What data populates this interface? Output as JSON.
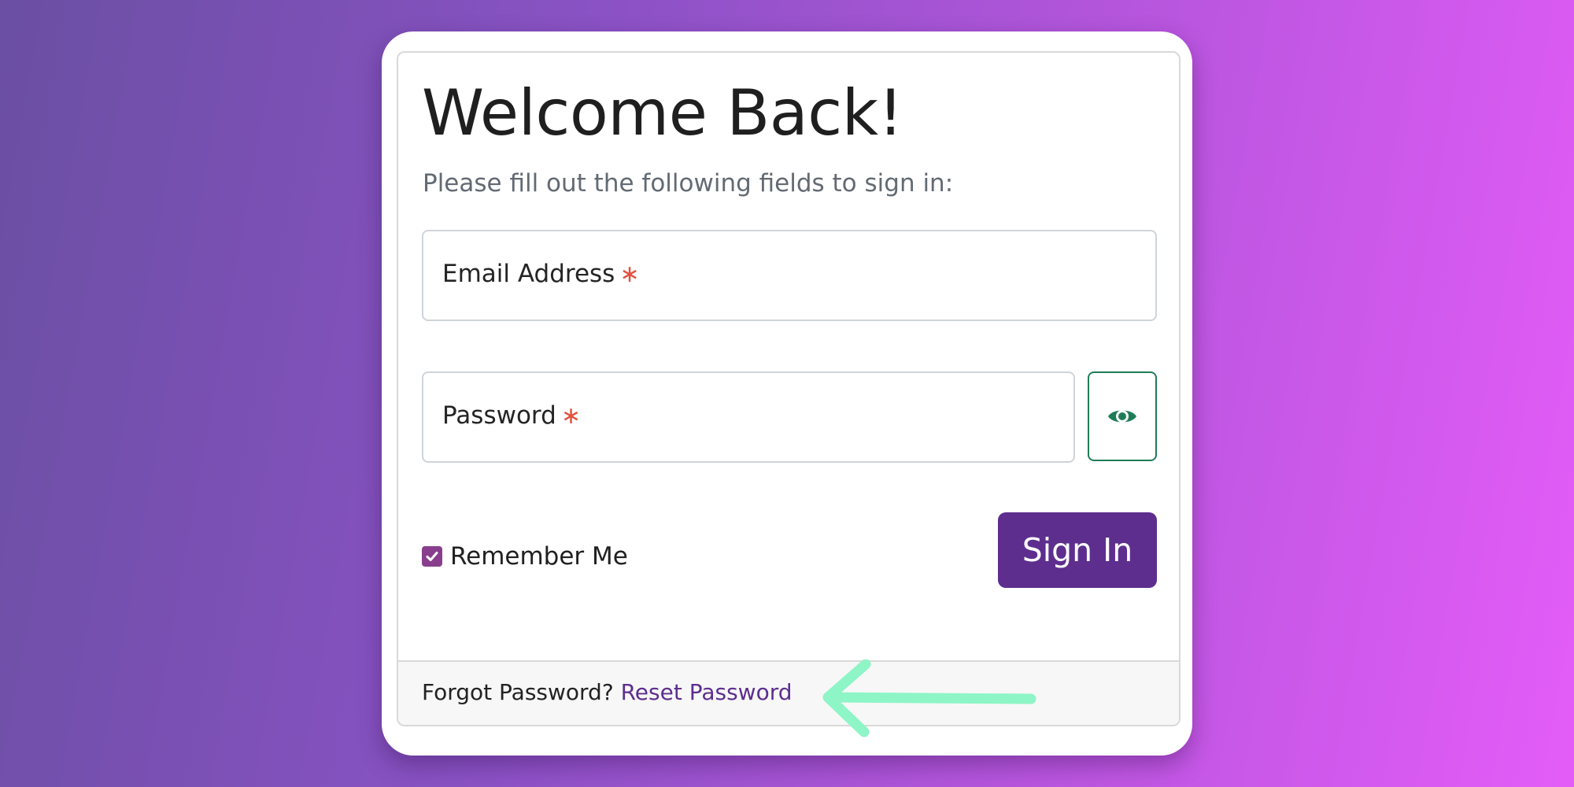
{
  "login_card": {
    "title": "Welcome Back!",
    "subtitle": "Please fill out the following fields to sign in:",
    "email_field": {
      "label": "Email Address",
      "required_mark": "∗",
      "value": ""
    },
    "password_field": {
      "label": "Password",
      "required_mark": "∗",
      "value": "",
      "toggle_icon": "eye-icon"
    },
    "remember_me": {
      "label": "Remember Me",
      "checked": true
    },
    "sign_in_label": "Sign In",
    "footer": {
      "prompt": "Forgot Password?",
      "link_label": "Reset Password"
    }
  },
  "annotation": {
    "icon": "arrow-left-icon",
    "color": "#8ef5c6"
  },
  "colors": {
    "primary": "#5d2e8e",
    "checkbox": "#883e8d",
    "eye_icon": "#1e7d56",
    "required_star": "#e1533f",
    "background_start": "#6a4fa3",
    "background_end": "#e45cf8"
  }
}
